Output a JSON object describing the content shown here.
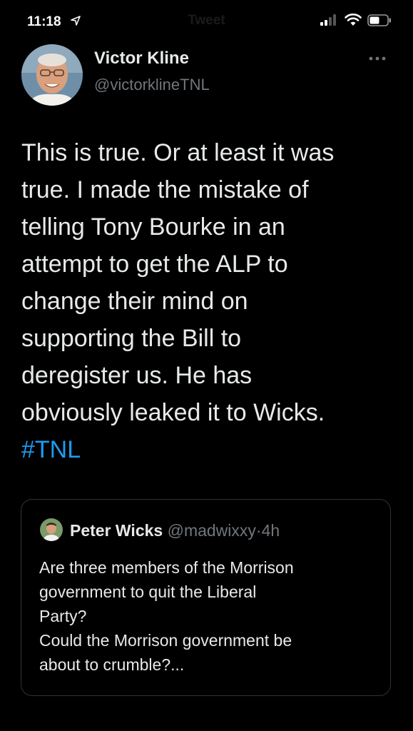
{
  "status_bar": {
    "time": "11:18",
    "nav_title": "Tweet"
  },
  "tweet": {
    "author": {
      "name": "Victor Kline",
      "handle": "@victorklineTNL"
    },
    "text_lines": [
      "This is true. Or at least it was",
      "true. I made the mistake of",
      "telling Tony Bourke in an",
      "attempt to get the ALP to",
      "change their mind on",
      "supporting the Bill to",
      "deregister us. He has",
      "obviously leaked it to Wicks."
    ],
    "hashtag": "#TNL"
  },
  "quoted_tweet": {
    "name": "Peter Wicks",
    "handle": "@madwixxy",
    "separator": "·",
    "time": "4h",
    "text_lines": [
      "Are three members of the Morrison",
      "government to quit the Liberal",
      "Party?",
      "Could the Morrison government be",
      "about to crumble?..."
    ]
  },
  "icons": {
    "location": "location-arrow-icon",
    "signal": "cellular-signal-icon",
    "wifi": "wifi-icon",
    "battery": "battery-icon",
    "more": "more-options-icon"
  },
  "colors": {
    "background": "#000000",
    "text": "#e7e9ea",
    "secondary_text": "#71767b",
    "link": "#1d9bf0",
    "border": "#2f3336"
  }
}
